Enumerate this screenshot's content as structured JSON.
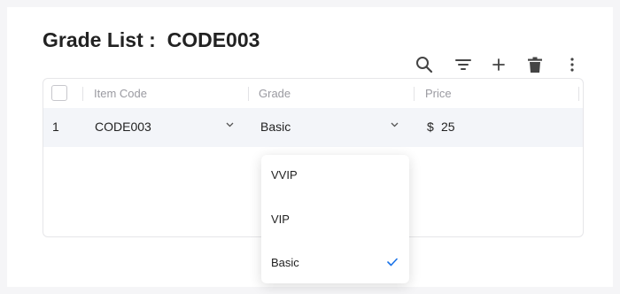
{
  "page": {
    "title": "Grade List :  CODE003"
  },
  "toolbar": {
    "icons": [
      "search-icon",
      "filter-icon",
      "plus-icon",
      "trash-icon",
      "more-vertical-icon"
    ]
  },
  "grid": {
    "columns": [
      "Item Code",
      "Grade",
      "Price"
    ],
    "rows": [
      {
        "index": "1",
        "item_code": "CODE003",
        "grade": "Basic",
        "currency": "$",
        "price": "25"
      }
    ]
  },
  "dropdown": {
    "options": [
      "VVIP",
      "VIP",
      "Basic"
    ],
    "selected": "Basic"
  },
  "colors": {
    "accent": "#1a73e8",
    "row_bg": "#f3f5f9",
    "icon": "#444444"
  }
}
